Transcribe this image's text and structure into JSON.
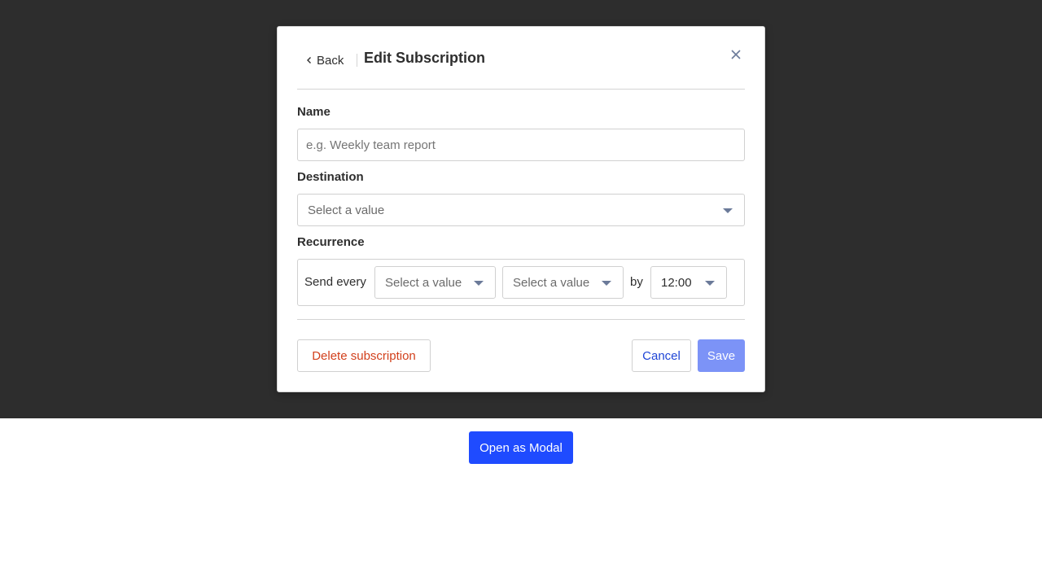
{
  "modal": {
    "back_label": "Back",
    "title": "Edit Subscription"
  },
  "form": {
    "name": {
      "label": "Name",
      "value": "",
      "placeholder": "e.g. Weekly team report"
    },
    "destination": {
      "label": "Destination",
      "selected": "Select a value"
    },
    "recurrence": {
      "label": "Recurrence",
      "send_every_label": "Send every",
      "interval_selected": "Select a value",
      "unit_selected": "Select a value",
      "by_label": "by",
      "time_selected": "12:00"
    }
  },
  "footer": {
    "delete_label": "Delete subscription",
    "cancel_label": "Cancel",
    "save_label": "Save"
  },
  "page": {
    "open_modal_label": "Open as Modal"
  },
  "colors": {
    "backdrop": "#2d2d2d",
    "danger": "#d2401c",
    "link": "#1f45d6",
    "primary": "#1f4bff",
    "primary_disabled": "#7c93f7"
  },
  "icons": {
    "back": "chevron-left-icon",
    "close": "close-icon",
    "dropdown": "caret-down-icon"
  }
}
